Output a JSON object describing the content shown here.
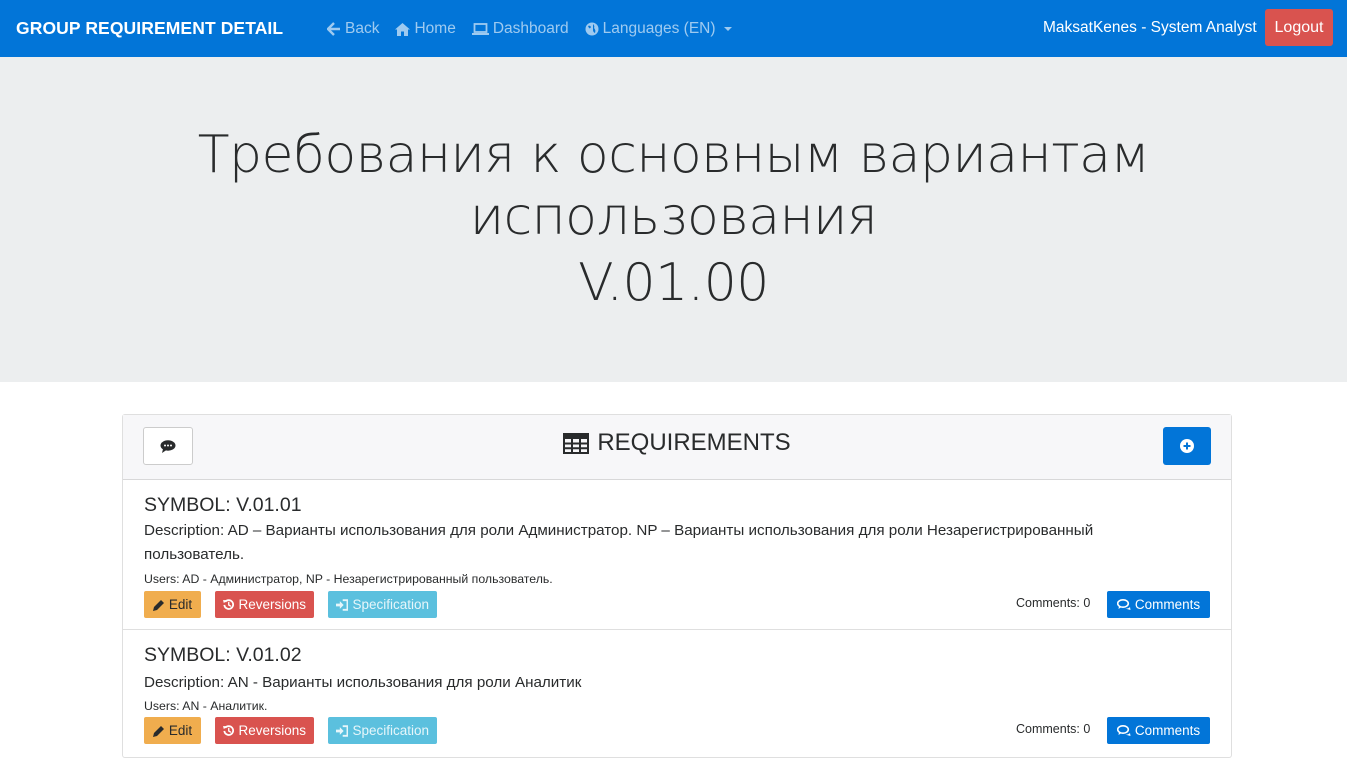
{
  "navbar": {
    "brand": "GROUP REQUIREMENT DETAIL",
    "links": [
      {
        "label": "Back",
        "icon": "arrow-left-icon"
      },
      {
        "label": "Home",
        "icon": "home-icon"
      },
      {
        "label": "Dashboard",
        "icon": "laptop-icon"
      },
      {
        "label": "Languages (EN)",
        "icon": "globe-icon"
      }
    ],
    "user": "MaksatKenes - System Analyst",
    "logout_label": "Logout"
  },
  "jumbotron": {
    "title_line1": "Требования к основным вариантам",
    "title_line2": "использования",
    "version": "V.01.00"
  },
  "card": {
    "header_title": "REQUIREMENTS",
    "requirements": [
      {
        "symbol": "SYMBOL: V.01.01",
        "description": "Description: AD – Варианты использования для роли Администратор. NP – Варианты использования для роли Незарегистрированный пользователь.",
        "users": "Users: AD - Администратор, NP - Незарегистрированный пользователь.",
        "edit_label": "Edit",
        "reversions_label": "Reversions",
        "specification_label": "Specification",
        "comments_count": "Comments: 0",
        "comments_label": "Comments"
      },
      {
        "symbol": "SYMBOL: V.01.02",
        "description": "Description: AN - Варианты использования для роли Аналитик",
        "users": "Users: AN - Аналитик.",
        "edit_label": "Edit",
        "reversions_label": "Reversions",
        "specification_label": "Specification",
        "comments_count": "Comments: 0",
        "comments_label": "Comments"
      }
    ]
  },
  "colors": {
    "primary": "#0275d8",
    "danger": "#d9534f",
    "warning": "#f0ad4e",
    "info": "#5bc0de",
    "jumbotron_bg": "#eceeef"
  }
}
